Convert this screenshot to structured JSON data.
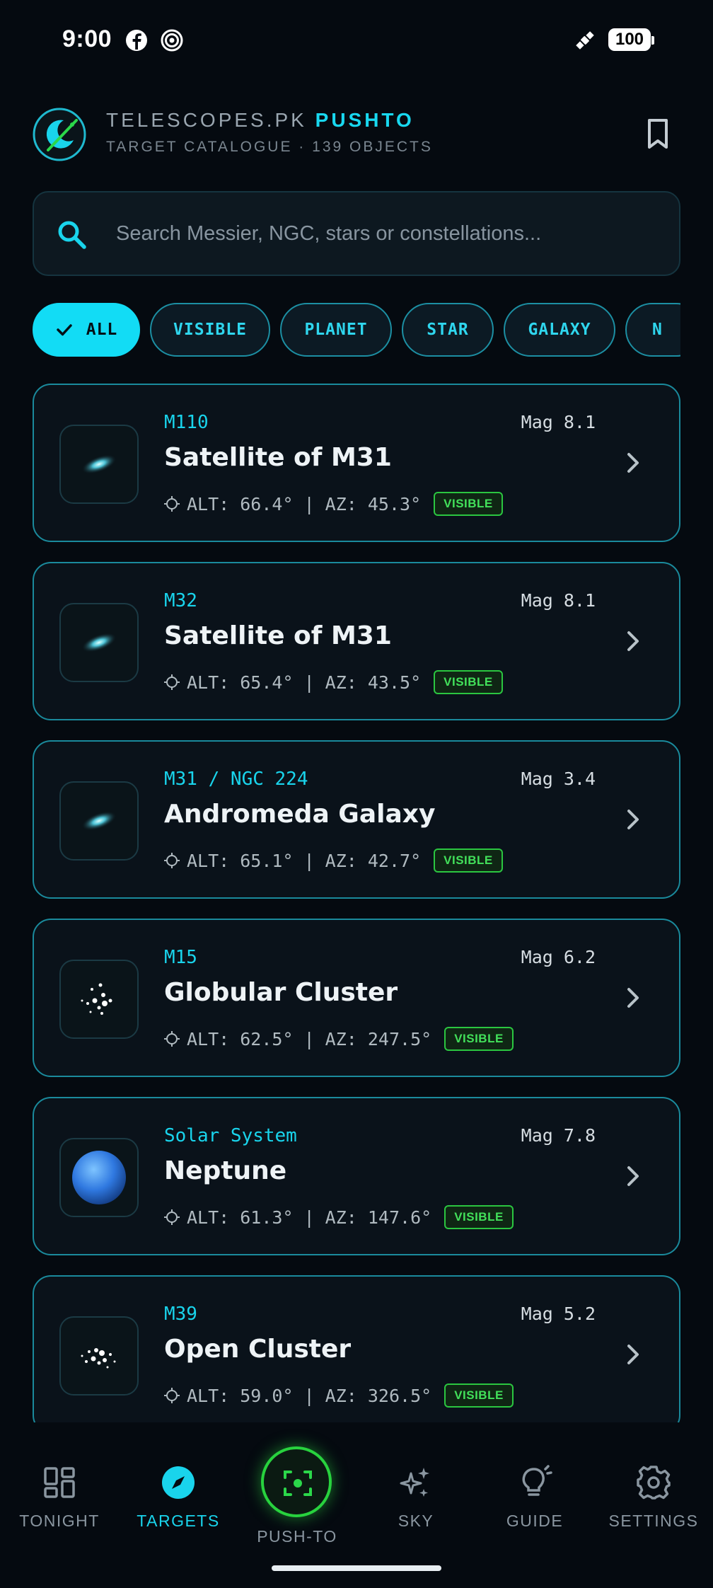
{
  "status_bar": {
    "time": "9:00",
    "battery": "100"
  },
  "header": {
    "title_main": "TELESCOPES.PK ",
    "title_accent": "PUSHTO",
    "subtitle": "TARGET CATALOGUE · 139 OBJECTS"
  },
  "search": {
    "placeholder": "Search Messier, NGC, stars or constellations..."
  },
  "filters": {
    "items": [
      {
        "label": "ALL",
        "active": true
      },
      {
        "label": "VISIBLE",
        "active": false
      },
      {
        "label": "PLANET",
        "active": false
      },
      {
        "label": "STAR",
        "active": false
      },
      {
        "label": "GALAXY",
        "active": false
      },
      {
        "label": "N",
        "active": false
      }
    ]
  },
  "targets": [
    {
      "catalog": "M110",
      "name": "Satellite of M31",
      "mag": "Mag 8.1",
      "coords": "ALT: 66.4° | AZ: 45.3°",
      "badge": "VISIBLE",
      "icon": "galaxy-icon"
    },
    {
      "catalog": "M32",
      "name": "Satellite of M31",
      "mag": "Mag 8.1",
      "coords": "ALT: 65.4° | AZ: 43.5°",
      "badge": "VISIBLE",
      "icon": "galaxy-icon"
    },
    {
      "catalog": "M31 / NGC 224",
      "name": "Andromeda Galaxy",
      "mag": "Mag 3.4",
      "coords": "ALT: 65.1° | AZ: 42.7°",
      "badge": "VISIBLE",
      "icon": "galaxy-icon"
    },
    {
      "catalog": "M15",
      "name": "Globular Cluster",
      "mag": "Mag 6.2",
      "coords": "ALT: 62.5° | AZ: 247.5°",
      "badge": "VISIBLE",
      "icon": "cluster-icon"
    },
    {
      "catalog": "Solar System",
      "name": "Neptune",
      "mag": "Mag 7.8",
      "coords": "ALT: 61.3° | AZ: 147.6°",
      "badge": "VISIBLE",
      "icon": "planet-icon"
    },
    {
      "catalog": "M39",
      "name": "Open Cluster",
      "mag": "Mag 5.2",
      "coords": "ALT: 59.0° | AZ: 326.5°",
      "badge": "VISIBLE",
      "icon": "cluster-icon"
    }
  ],
  "nav": {
    "tonight": "TONIGHT",
    "targets": "TARGETS",
    "push_to": "PUSH-TO",
    "sky": "SKY",
    "guide": "GUIDE",
    "settings": "SETTINGS"
  },
  "colors": {
    "accent": "#19d4ec",
    "visible_green": "#42e05a",
    "background": "#050a10"
  }
}
